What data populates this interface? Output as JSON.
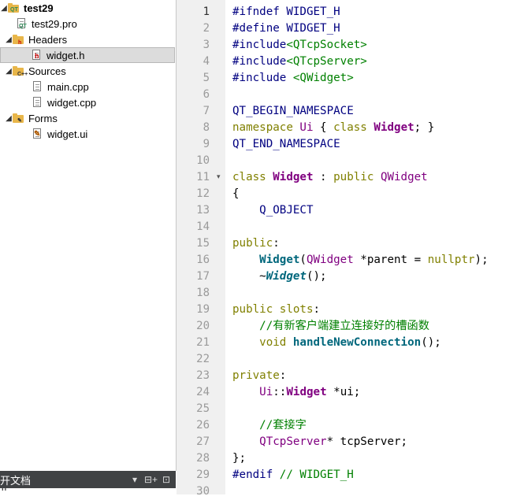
{
  "project_tree": {
    "project_name": "test29",
    "items": [
      {
        "label": "test29",
        "kind": "project"
      },
      {
        "label": "test29.pro",
        "kind": "pro-file"
      },
      {
        "label": "Headers",
        "kind": "folder"
      },
      {
        "label": "widget.h",
        "kind": "header-file",
        "selected": true
      },
      {
        "label": "Sources",
        "kind": "folder"
      },
      {
        "label": "main.cpp",
        "kind": "source-file"
      },
      {
        "label": "widget.cpp",
        "kind": "source-file"
      },
      {
        "label": "Forms",
        "kind": "folder"
      },
      {
        "label": "widget.ui",
        "kind": "form-file"
      }
    ]
  },
  "bottom_panel": {
    "title": "开文档",
    "controls": [
      "▾",
      "⊟+",
      "⊡"
    ],
    "peek_text": "h  *  "
  },
  "editor": {
    "current_line": 1,
    "fold_marker_line": 11,
    "lines": [
      "#ifndef WIDGET_H",
      "#define WIDGET_H",
      "#include<QTcpSocket>",
      "#include<QTcpServer>",
      "#include <QWidget>",
      "",
      "QT_BEGIN_NAMESPACE",
      "namespace Ui { class Widget; }",
      "QT_END_NAMESPACE",
      "",
      "class Widget : public QWidget",
      "{",
      "    Q_OBJECT",
      "",
      "public:",
      "    Widget(QWidget *parent = nullptr);",
      "    ~Widget();",
      "",
      "public slots:",
      "    //有新客户端建立连接好的槽函数",
      "    void handleNewConnection();",
      "",
      "private:",
      "    Ui::Widget *ui;",
      "",
      "    //套接字",
      "    QTcpServer* tcpServer;",
      "};",
      "#endif // WIDGET_H",
      ""
    ],
    "line_numbers": [
      "1",
      "2",
      "3",
      "4",
      "5",
      "6",
      "7",
      "8",
      "9",
      "10",
      "11",
      "12",
      "13",
      "14",
      "15",
      "16",
      "17",
      "18",
      "19",
      "20",
      "21",
      "22",
      "23",
      "24",
      "25",
      "26",
      "27",
      "28",
      "29",
      "30"
    ]
  },
  "colors": {
    "preprocessor": "#000080",
    "include_path": "#008000",
    "keyword": "#808000",
    "class_name": "#800080",
    "function": "#00677c",
    "comment": "#008000",
    "gutter_bg": "#f0f0f0",
    "panel_bar": "#404244"
  }
}
